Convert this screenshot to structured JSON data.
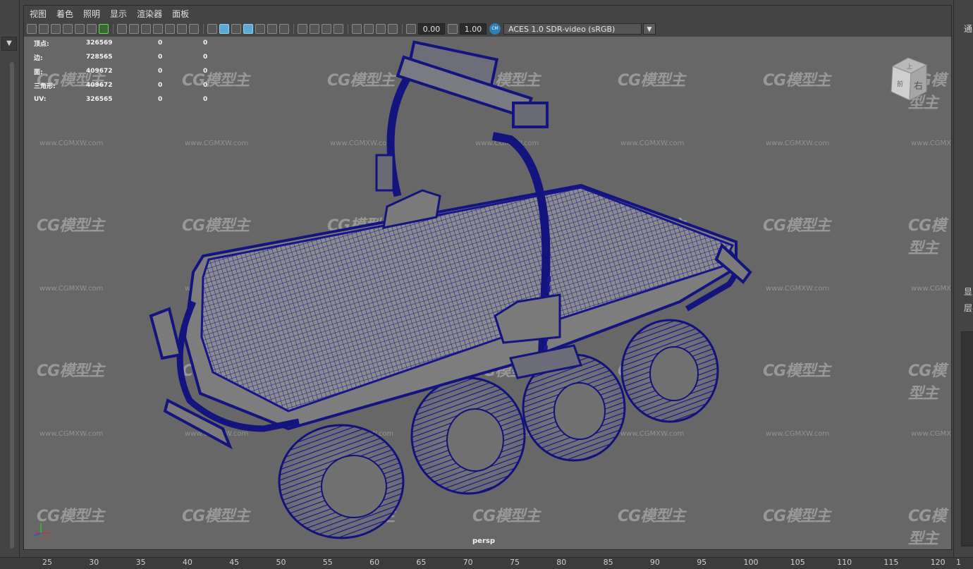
{
  "menu": [
    "视图",
    "着色",
    "照明",
    "显示",
    "渲染器",
    "面板"
  ],
  "toolbar": {
    "exposure_value": "0.00",
    "gamma_value": "1.00",
    "color_space": "ACES 1.0 SDR-video (sRGB)"
  },
  "hud": {
    "rows": [
      {
        "label": "顶点:",
        "v1": "326569",
        "v2": "0",
        "v3": "0"
      },
      {
        "label": "边:",
        "v1": "728565",
        "v2": "0",
        "v3": "0"
      },
      {
        "label": "面:",
        "v1": "409672",
        "v2": "0",
        "v3": "0"
      },
      {
        "label": "三角形:",
        "v1": "409672",
        "v2": "0",
        "v3": "0"
      },
      {
        "label": "UV:",
        "v1": "326565",
        "v2": "0",
        "v3": "0"
      }
    ]
  },
  "viewcube": {
    "top_face": "上",
    "right_face": "右",
    "front_face": "前"
  },
  "camera_label": "persp",
  "watermark": {
    "logo": "CG模型主",
    "url": "www.CGMXW.com"
  },
  "right_panel": {
    "label_top": "通",
    "label_mid1": "显",
    "label_mid2": "层"
  },
  "left_panel": {
    "dropdown_glyph": "▼"
  },
  "ruler_ticks": [
    "25",
    "30",
    "35",
    "40",
    "45",
    "50",
    "55",
    "60",
    "65",
    "70",
    "75",
    "80",
    "85",
    "90",
    "95",
    "100",
    "105",
    "110",
    "115",
    "120"
  ],
  "ruler_tail": "1",
  "colors": {
    "viewport_bg": "#676767",
    "wireframe": "#1a1a8c",
    "mesh_fill": "#8a8a8a",
    "selection_blue": "#5aa9d6"
  }
}
